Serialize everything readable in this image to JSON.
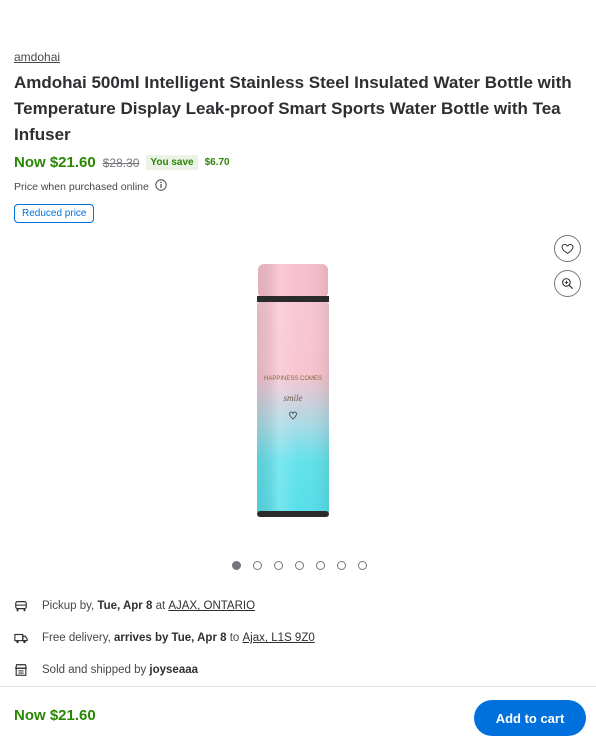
{
  "product": {
    "brand": "amdohai",
    "title": "Amdohai 500ml Intelligent Stainless Steel Insulated Water Bottle with Temperature Display Leak-proof Smart Sports Water Bottle with Tea Infuser"
  },
  "price": {
    "now": "Now $21.60",
    "was": "$28.30",
    "save_label": "You save",
    "save_amount": "$6.70",
    "online_note": "Price when purchased online",
    "reduced_tag": "Reduced price"
  },
  "gallery": {
    "image_text_1": "HAPPINESS COMES",
    "image_text_2": "smile",
    "dot_count": 7,
    "active_index": 0
  },
  "fulfillment": {
    "pickup_prefix": "Pickup by,",
    "pickup_date": "Tue, Apr 8",
    "pickup_at": "at",
    "pickup_store": "AJAX, ONTARIO",
    "delivery_prefix": "Free delivery,",
    "delivery_date": "arrives by Tue, Apr 8",
    "delivery_to": "to",
    "delivery_location": "Ajax, L1S 9Z0",
    "sold_prefix": "Sold and shipped by",
    "seller": "joyseaaa"
  },
  "bottom_bar": {
    "price": "Now $21.60",
    "cart_label": "Add to cart"
  },
  "colors": {
    "price_green": "#2a8703",
    "primary_blue": "#0071dc",
    "bottle_pink": "#f7bfcf",
    "bottle_blue": "#5fe3ec"
  }
}
